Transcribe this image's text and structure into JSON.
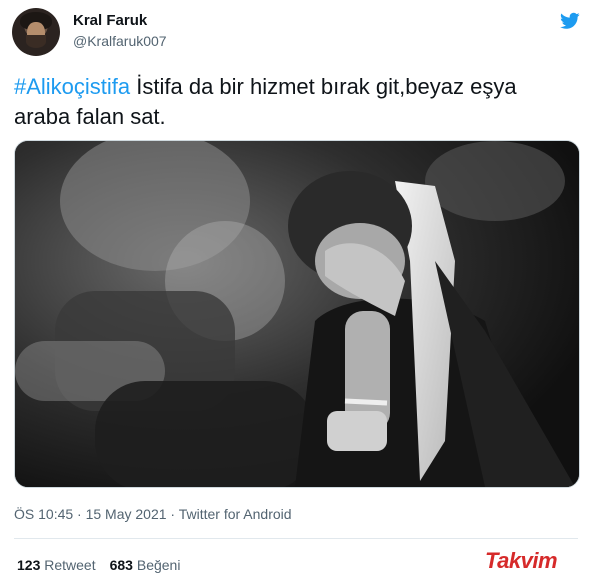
{
  "author": {
    "name": "Kral Faruk",
    "handle": "@Kralfaruk007"
  },
  "tweet": {
    "hashtag": "#Alikoçistifa",
    "text": " İstifa da bir hizmet bırak git,beyaz eşya araba falan sat."
  },
  "meta": {
    "timestamp": "ÖS 10:45 · 15 May 2021 · Twitter for Android"
  },
  "stats": {
    "retweets_count": "123",
    "retweets_label": "Retweet",
    "likes_count": "683",
    "likes_label": "Beğeni"
  },
  "watermark": {
    "text": "Takvim"
  },
  "icons": {
    "brand": "twitter-bird-icon"
  },
  "colors": {
    "accent": "#1d9bf0",
    "secondary_text": "#536471",
    "watermark": "#d62a2a"
  }
}
